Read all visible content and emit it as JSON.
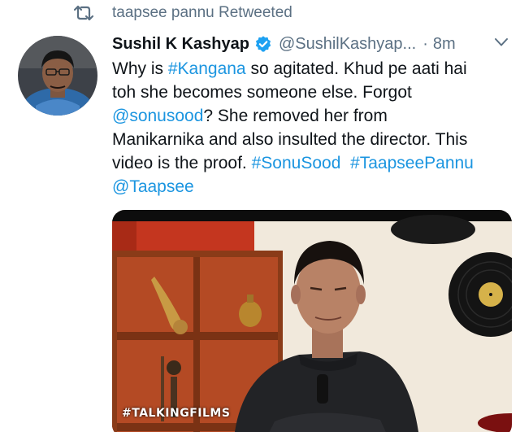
{
  "retweet": {
    "text": "taapsee pannu Retweeted",
    "icon": "retweet-icon"
  },
  "author": {
    "name": "Sushil K Kashyap",
    "handle": "@SushilKashyap...",
    "separator": "·",
    "time": "8m",
    "verified": true
  },
  "tweet": {
    "lines": [
      [
        {
          "text": "Why is ",
          "type": "text"
        },
        {
          "text": "#Kangana",
          "type": "link"
        },
        {
          "text": " so agitated. Khud pe aati hai",
          "type": "text"
        }
      ],
      [
        {
          "text": "toh she becomes someone else. Forgot",
          "type": "text"
        }
      ],
      [
        {
          "text": "@sonusood",
          "type": "link"
        },
        {
          "text": "? She removed her from",
          "type": "text"
        }
      ],
      [
        {
          "text": "Manikarnika and also insulted the director. This",
          "type": "text"
        }
      ],
      [
        {
          "text": "video is the proof. ",
          "type": "text"
        },
        {
          "text": "#SonuSood",
          "type": "link"
        },
        {
          "text": "  ",
          "type": "text"
        },
        {
          "text": "#TaapseePannu",
          "type": "link"
        }
      ],
      [
        {
          "text": "@Taapsee",
          "type": "link"
        }
      ]
    ]
  },
  "media": {
    "watermark": "#TALKINGFILMS"
  },
  "colors": {
    "link": "#1b95e0",
    "muted": "#5b7083",
    "verified": "#1da1f2"
  }
}
